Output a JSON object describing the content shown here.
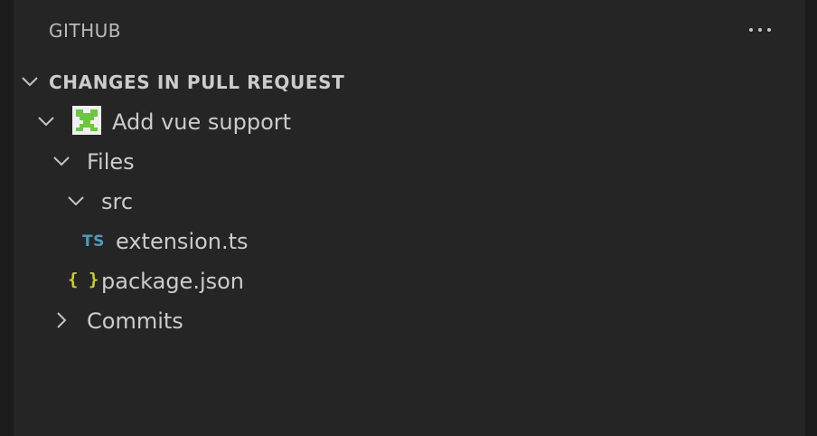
{
  "view": {
    "title": "GITHUB",
    "more_actions_icon": "ellipsis-icon"
  },
  "section": {
    "title": "CHANGES IN PULL REQUEST",
    "expanded": true
  },
  "tree": {
    "pull_request": {
      "label": "Add vue support",
      "avatar_icon": "identicon-avatar",
      "expanded": true
    },
    "files": {
      "label": "Files",
      "expanded": true
    },
    "src": {
      "label": "src",
      "expanded": true
    },
    "extension_ts": {
      "label": "extension.ts",
      "icon_text": "TS"
    },
    "package_json": {
      "label": "package.json",
      "icon_text": "{ }"
    },
    "commits": {
      "label": "Commits",
      "expanded": false
    }
  },
  "colors": {
    "sidebar_bg": "#252526",
    "outer_bg": "#1b1b1b",
    "text": "#cccccc",
    "ts_icon": "#519aba",
    "json_icon": "#cbcb41",
    "avatar_green": "#6cc644"
  }
}
